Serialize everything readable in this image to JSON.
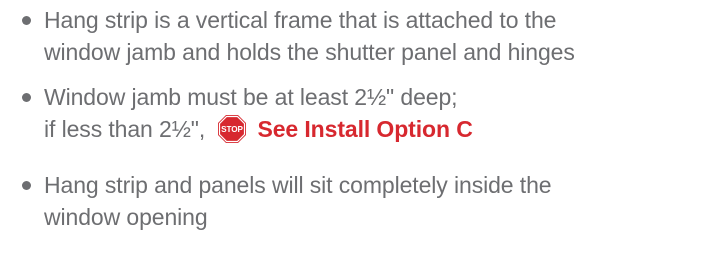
{
  "bullets": [
    {
      "line1": "Hang strip is a vertical frame that is attached to the",
      "line2": "window jamb and holds the shutter panel and hinges"
    },
    {
      "line1": "Window jamb must be at least 2½\" deep;",
      "line2_prefix": "if less than 2½\",",
      "stop_icon": "stop-sign-icon",
      "stop_text": "STOP",
      "link_text": "See Install Option C"
    },
    {
      "line1": "Hang strip and panels will sit completely inside the",
      "line2": "window opening"
    }
  ],
  "colors": {
    "text": "#6d6e71",
    "accent": "#d7282f"
  }
}
